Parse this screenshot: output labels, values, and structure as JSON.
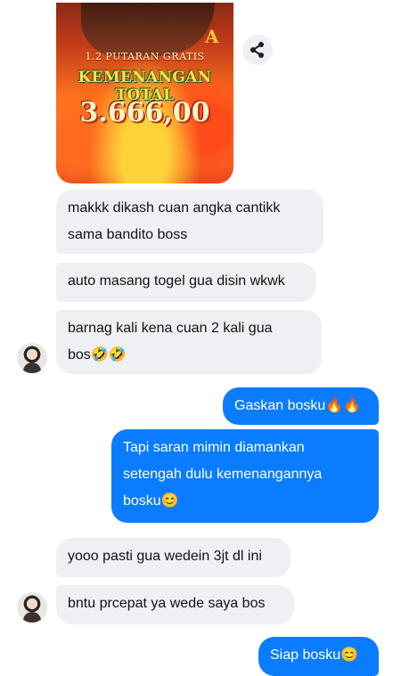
{
  "promo": {
    "subtitle": "1.2 PUTARAN GRATIS",
    "title": "KEMENANGAN TOTAL",
    "amount": "3.666,00"
  },
  "messages": [
    {
      "id": "m1",
      "side": "in",
      "text": "makkk dikash cuan angka cantikk\nsama bandito boss"
    },
    {
      "id": "m2",
      "side": "in",
      "text": "auto masang togel gua disin wkwk"
    },
    {
      "id": "m3",
      "side": "in",
      "text": "barnag kali kena cuan 2 kali gua\nbos🤣🤣"
    },
    {
      "id": "m4",
      "side": "out",
      "text": "Gaskan bosku🔥🔥"
    },
    {
      "id": "m5",
      "side": "out",
      "text": "Tapi saran mimin diamankan\nsetengah dulu kemenangannya\nbosku😊"
    },
    {
      "id": "m6",
      "side": "in",
      "text": "yooo pasti gua wedein 3jt dl ini"
    },
    {
      "id": "m7",
      "side": "in",
      "text": "bntu prcepat ya wede saya bos"
    },
    {
      "id": "m8",
      "side": "out",
      "text": "Siap bosku😊"
    }
  ],
  "icons": {
    "share": "share-icon",
    "avatar": "avatar"
  },
  "colors": {
    "incoming_bubble": "#eef0f3",
    "outgoing_bubble": "#0a7cff",
    "background": "#ffffff"
  }
}
